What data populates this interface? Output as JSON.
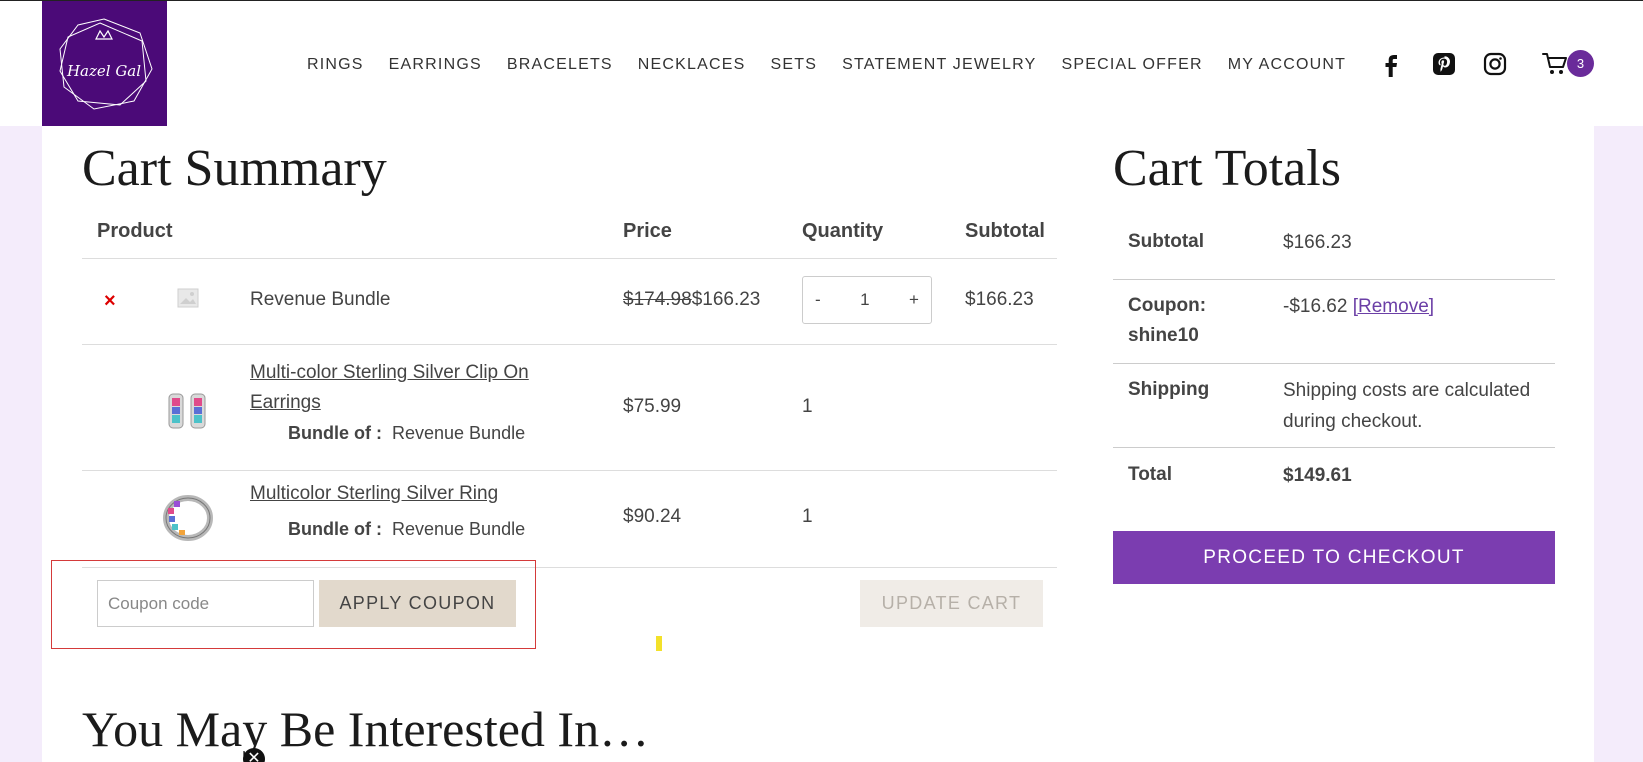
{
  "brand": {
    "logo_text": "Hazel Gal",
    "colors": {
      "logo_bg": "#4b0a78",
      "accent": "#7b3db0",
      "badge": "#6a2b9a",
      "remove_x": "#dd0000",
      "coupon_button_bg": "#e2d9cc",
      "page_bg": "#f4ecfb"
    }
  },
  "nav": {
    "items": [
      "RINGS",
      "EARRINGS",
      "BRACELETS",
      "NECKLACES",
      "SETS",
      "STATEMENT JEWELRY",
      "SPECIAL OFFER",
      "MY ACCOUNT"
    ]
  },
  "header_icons": {
    "social": [
      "facebook-icon",
      "pinterest-icon",
      "instagram-icon"
    ],
    "cart_icon": "cart-icon",
    "cart_count": "3"
  },
  "cart_summary": {
    "title": "Cart Summary",
    "columns": {
      "product": "Product",
      "price": "Price",
      "quantity": "Quantity",
      "subtotal": "Subtotal"
    },
    "rows": [
      {
        "name": "Revenue Bundle",
        "old_price": "$174.98",
        "price": "$166.23",
        "quantity": "1",
        "subtotal": "$166.23",
        "remove_symbol": "×",
        "qty_minus": "-",
        "qty_plus": "+"
      },
      {
        "name": "Multi-color Sterling Silver Clip On Earrings",
        "name_line1": "Multi-color Sterling Silver Clip On",
        "name_line2": "Earrings",
        "bundle_label": "Bundle of :",
        "bundle_name": "Revenue Bundle",
        "price": "$75.99",
        "quantity": "1"
      },
      {
        "name": "Multicolor Sterling Silver Ring",
        "bundle_label": "Bundle of :",
        "bundle_name": "Revenue Bundle",
        "price": "$90.24",
        "quantity": "1"
      }
    ],
    "coupon": {
      "placeholder": "Coupon code",
      "apply_label": "APPLY COUPON"
    },
    "update_label": "UPDATE CART"
  },
  "cart_totals": {
    "title": "Cart Totals",
    "subtotal_label": "Subtotal",
    "subtotal_value": "$166.23",
    "coupon_label_line1": "Coupon:",
    "coupon_label_line2": "shine10",
    "coupon_value": "-$16.62",
    "coupon_remove": "[Remove]",
    "shipping_label": "Shipping",
    "shipping_line1": "Shipping costs are calculated",
    "shipping_line2": "during checkout.",
    "total_label": "Total",
    "total_value": "$149.61",
    "checkout_label": "PROCEED TO CHECKOUT"
  },
  "related": {
    "title": "You May Be Interested In…"
  }
}
